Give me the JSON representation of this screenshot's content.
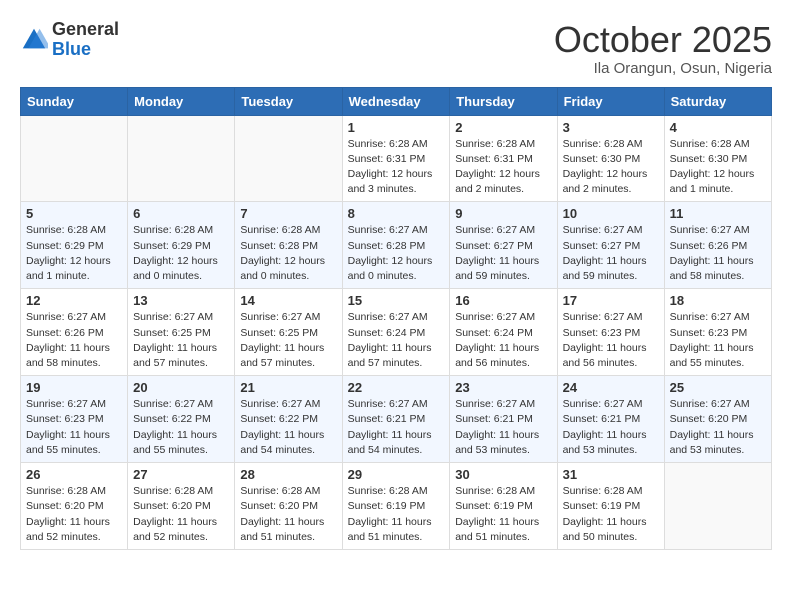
{
  "header": {
    "logo_general": "General",
    "logo_blue": "Blue",
    "month_title": "October 2025",
    "location": "Ila Orangun, Osun, Nigeria"
  },
  "days_of_week": [
    "Sunday",
    "Monday",
    "Tuesday",
    "Wednesday",
    "Thursday",
    "Friday",
    "Saturday"
  ],
  "weeks": [
    [
      {
        "day": "",
        "info": ""
      },
      {
        "day": "",
        "info": ""
      },
      {
        "day": "",
        "info": ""
      },
      {
        "day": "1",
        "info": "Sunrise: 6:28 AM\nSunset: 6:31 PM\nDaylight: 12 hours and 3 minutes."
      },
      {
        "day": "2",
        "info": "Sunrise: 6:28 AM\nSunset: 6:31 PM\nDaylight: 12 hours and 2 minutes."
      },
      {
        "day": "3",
        "info": "Sunrise: 6:28 AM\nSunset: 6:30 PM\nDaylight: 12 hours and 2 minutes."
      },
      {
        "day": "4",
        "info": "Sunrise: 6:28 AM\nSunset: 6:30 PM\nDaylight: 12 hours and 1 minute."
      }
    ],
    [
      {
        "day": "5",
        "info": "Sunrise: 6:28 AM\nSunset: 6:29 PM\nDaylight: 12 hours and 1 minute."
      },
      {
        "day": "6",
        "info": "Sunrise: 6:28 AM\nSunset: 6:29 PM\nDaylight: 12 hours and 0 minutes."
      },
      {
        "day": "7",
        "info": "Sunrise: 6:28 AM\nSunset: 6:28 PM\nDaylight: 12 hours and 0 minutes."
      },
      {
        "day": "8",
        "info": "Sunrise: 6:27 AM\nSunset: 6:28 PM\nDaylight: 12 hours and 0 minutes."
      },
      {
        "day": "9",
        "info": "Sunrise: 6:27 AM\nSunset: 6:27 PM\nDaylight: 11 hours and 59 minutes."
      },
      {
        "day": "10",
        "info": "Sunrise: 6:27 AM\nSunset: 6:27 PM\nDaylight: 11 hours and 59 minutes."
      },
      {
        "day": "11",
        "info": "Sunrise: 6:27 AM\nSunset: 6:26 PM\nDaylight: 11 hours and 58 minutes."
      }
    ],
    [
      {
        "day": "12",
        "info": "Sunrise: 6:27 AM\nSunset: 6:26 PM\nDaylight: 11 hours and 58 minutes."
      },
      {
        "day": "13",
        "info": "Sunrise: 6:27 AM\nSunset: 6:25 PM\nDaylight: 11 hours and 57 minutes."
      },
      {
        "day": "14",
        "info": "Sunrise: 6:27 AM\nSunset: 6:25 PM\nDaylight: 11 hours and 57 minutes."
      },
      {
        "day": "15",
        "info": "Sunrise: 6:27 AM\nSunset: 6:24 PM\nDaylight: 11 hours and 57 minutes."
      },
      {
        "day": "16",
        "info": "Sunrise: 6:27 AM\nSunset: 6:24 PM\nDaylight: 11 hours and 56 minutes."
      },
      {
        "day": "17",
        "info": "Sunrise: 6:27 AM\nSunset: 6:23 PM\nDaylight: 11 hours and 56 minutes."
      },
      {
        "day": "18",
        "info": "Sunrise: 6:27 AM\nSunset: 6:23 PM\nDaylight: 11 hours and 55 minutes."
      }
    ],
    [
      {
        "day": "19",
        "info": "Sunrise: 6:27 AM\nSunset: 6:23 PM\nDaylight: 11 hours and 55 minutes."
      },
      {
        "day": "20",
        "info": "Sunrise: 6:27 AM\nSunset: 6:22 PM\nDaylight: 11 hours and 55 minutes."
      },
      {
        "day": "21",
        "info": "Sunrise: 6:27 AM\nSunset: 6:22 PM\nDaylight: 11 hours and 54 minutes."
      },
      {
        "day": "22",
        "info": "Sunrise: 6:27 AM\nSunset: 6:21 PM\nDaylight: 11 hours and 54 minutes."
      },
      {
        "day": "23",
        "info": "Sunrise: 6:27 AM\nSunset: 6:21 PM\nDaylight: 11 hours and 53 minutes."
      },
      {
        "day": "24",
        "info": "Sunrise: 6:27 AM\nSunset: 6:21 PM\nDaylight: 11 hours and 53 minutes."
      },
      {
        "day": "25",
        "info": "Sunrise: 6:27 AM\nSunset: 6:20 PM\nDaylight: 11 hours and 53 minutes."
      }
    ],
    [
      {
        "day": "26",
        "info": "Sunrise: 6:28 AM\nSunset: 6:20 PM\nDaylight: 11 hours and 52 minutes."
      },
      {
        "day": "27",
        "info": "Sunrise: 6:28 AM\nSunset: 6:20 PM\nDaylight: 11 hours and 52 minutes."
      },
      {
        "day": "28",
        "info": "Sunrise: 6:28 AM\nSunset: 6:20 PM\nDaylight: 11 hours and 51 minutes."
      },
      {
        "day": "29",
        "info": "Sunrise: 6:28 AM\nSunset: 6:19 PM\nDaylight: 11 hours and 51 minutes."
      },
      {
        "day": "30",
        "info": "Sunrise: 6:28 AM\nSunset: 6:19 PM\nDaylight: 11 hours and 51 minutes."
      },
      {
        "day": "31",
        "info": "Sunrise: 6:28 AM\nSunset: 6:19 PM\nDaylight: 11 hours and 50 minutes."
      },
      {
        "day": "",
        "info": ""
      }
    ]
  ]
}
